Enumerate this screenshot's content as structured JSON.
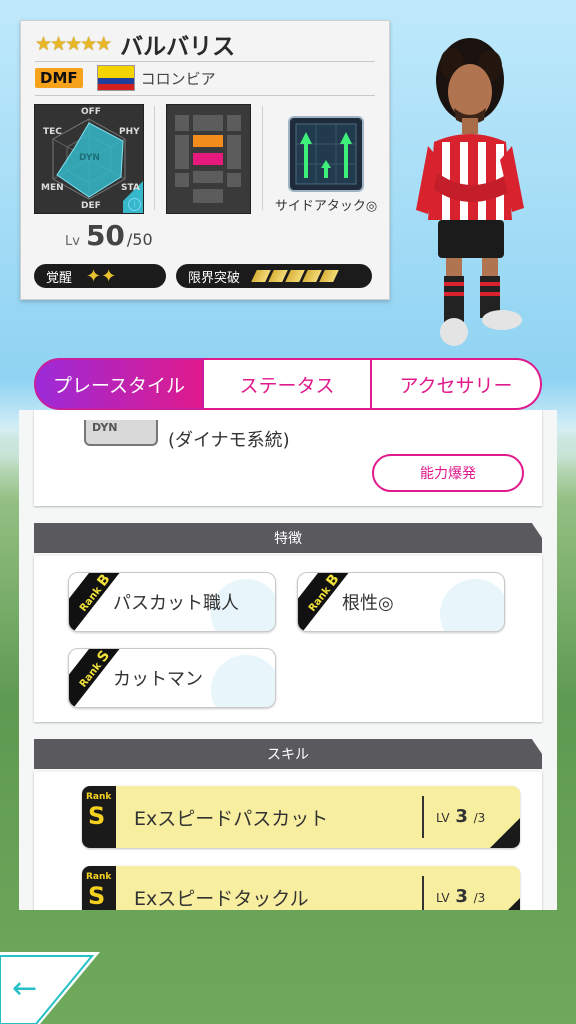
{
  "player": {
    "stars": "★★★★★",
    "name": "バルバリス",
    "position": "DMF",
    "country": "コロンビア",
    "radar_labels": [
      "OFF",
      "PHY",
      "STA",
      "DEF",
      "MEN",
      "TEC"
    ],
    "radar_center": "DYN",
    "attack_style": "サイドアタック◎",
    "lv_label": "Lv",
    "level": "50",
    "level_max": "/50",
    "awakening_label": "覚醒",
    "awakening_stars": "✦✦",
    "limit_label": "限界突破",
    "limit_break": 5,
    "flag_colors": [
      "#f5d300",
      "#1f3f9c",
      "#d42020"
    ]
  },
  "tabs": [
    {
      "label": "プレースタイル",
      "active": true
    },
    {
      "label": "ステータス",
      "active": false
    },
    {
      "label": "アクセサリー",
      "active": false
    }
  ],
  "playstyle": {
    "type_icon": "DYN",
    "type_text": "(ダイナモ系統)",
    "burst_button": "能力爆発"
  },
  "traits_section": {
    "title": "特徴",
    "items": [
      {
        "rank_word": "Rank",
        "rank": "B",
        "name": "パスカット職人"
      },
      {
        "rank_word": "Rank",
        "rank": "B",
        "name": "根性◎"
      },
      {
        "rank_word": "Rank",
        "rank": "S",
        "name": "カットマン"
      }
    ]
  },
  "skills_section": {
    "title": "スキル",
    "items": [
      {
        "rank_word": "Rank",
        "rank": "S",
        "name": "Exスピードパスカット",
        "lv_prefix": "LV",
        "lv": "3",
        "lv_max": "/3"
      },
      {
        "rank_word": "Rank",
        "rank": "S",
        "name": "Exスピードタックル",
        "lv_prefix": "LV",
        "lv": "3",
        "lv_max": "/3"
      }
    ]
  },
  "navigation": {
    "back_icon": "←"
  },
  "colors": {
    "accent": "#e01a8c",
    "accent_gradient_start": "#9b2bd8",
    "position_badge": "#f6a21b",
    "skill_bg": "#f8ee9f"
  }
}
